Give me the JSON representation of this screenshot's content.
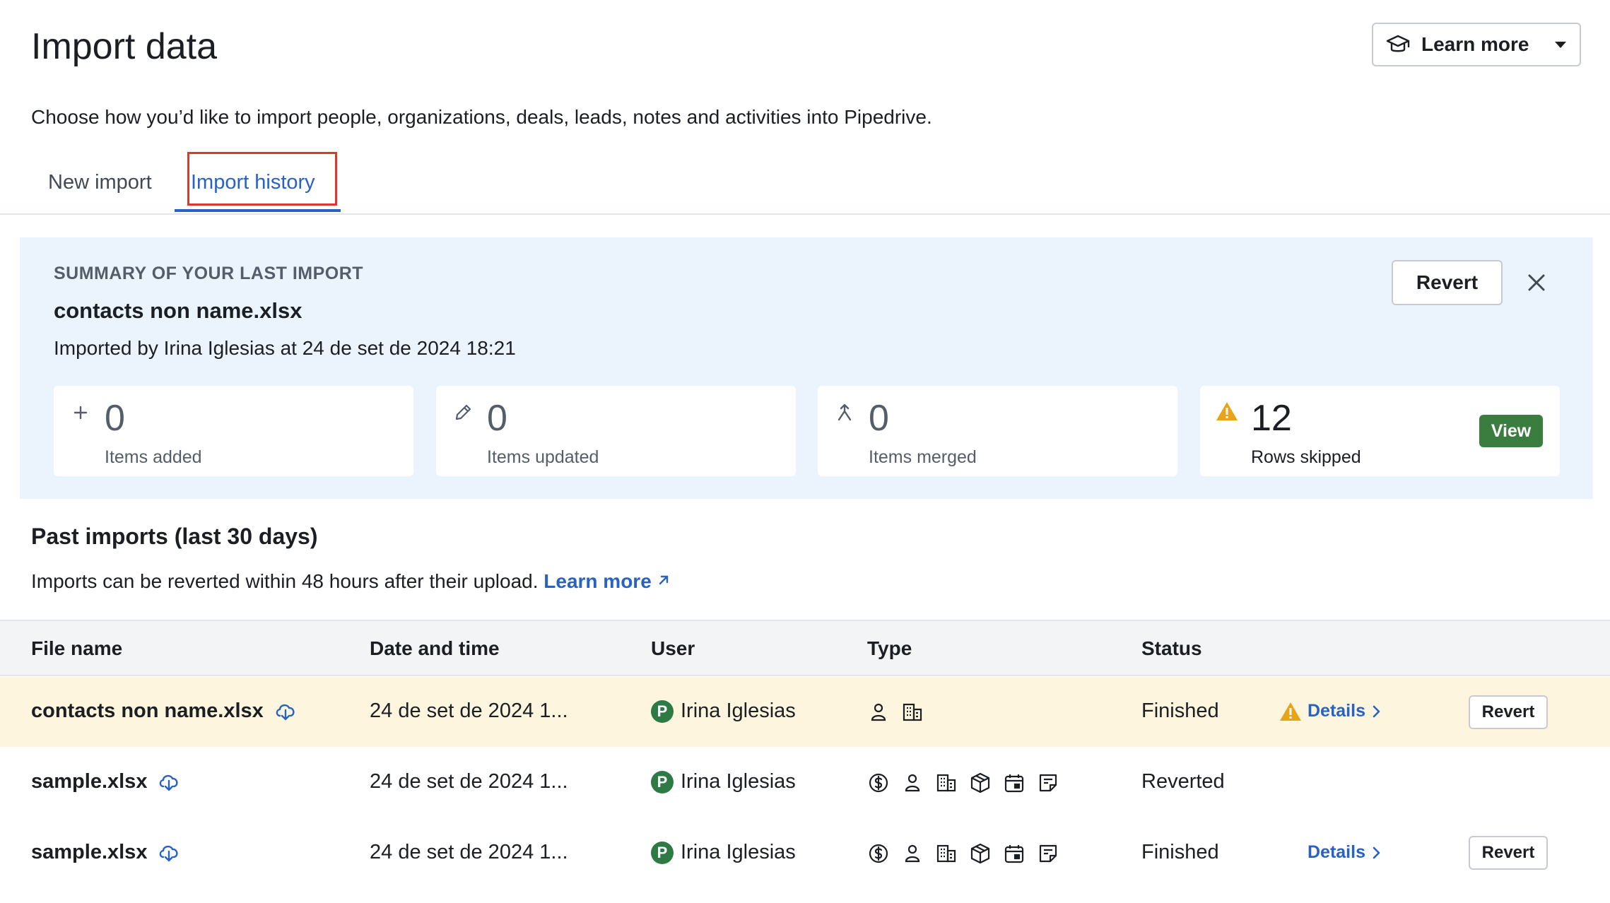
{
  "page": {
    "title": "Import data",
    "subtitle": "Choose how you’d like to import people, organizations, deals, leads, notes and activities into Pipedrive.",
    "learn_more_label": "Learn more"
  },
  "tabs": [
    {
      "label": "New import",
      "active": false
    },
    {
      "label": "Import history",
      "active": true
    }
  ],
  "summary": {
    "heading": "SUMMARY OF YOUR LAST IMPORT",
    "file_name": "contacts non name.xlsx",
    "imported_by": "Imported by Irina Iglesias at 24 de set de 2024 18:21",
    "revert_label": "Revert",
    "cards": [
      {
        "icon": "plus-icon",
        "value": "0",
        "label": "Items added"
      },
      {
        "icon": "pencil-icon",
        "value": "0",
        "label": "Items updated"
      },
      {
        "icon": "merge-icon",
        "value": "0",
        "label": "Items merged"
      },
      {
        "icon": "warning-icon",
        "value": "12",
        "label": "Rows skipped",
        "action_label": "View"
      }
    ]
  },
  "past": {
    "title": "Past imports (last 30 days)",
    "note": "Imports can be reverted within 48 hours after their upload.",
    "note_link": "Learn more",
    "columns": [
      "File name",
      "Date and time",
      "User",
      "Type",
      "Status"
    ],
    "rows": [
      {
        "file": "contacts non name.xlsx",
        "date": "24 de set de 2024 1...",
        "user": "Irina Iglesias",
        "avatar_letter": "P",
        "types": [
          "person-icon",
          "organization-icon"
        ],
        "status": "Finished",
        "details_label": "Details",
        "has_warning": true,
        "revert_label": "Revert",
        "highlighted": true
      },
      {
        "file": "sample.xlsx",
        "date": "24 de set de 2024 1...",
        "user": "Irina Iglesias",
        "avatar_letter": "P",
        "types": [
          "deal-icon",
          "person-icon",
          "organization-icon",
          "product-icon",
          "activity-icon",
          "note-icon"
        ],
        "status": "Reverted",
        "highlighted": false
      },
      {
        "file": "sample.xlsx",
        "date": "24 de set de 2024 1...",
        "user": "Irina Iglesias",
        "avatar_letter": "P",
        "types": [
          "deal-icon",
          "person-icon",
          "organization-icon",
          "product-icon",
          "activity-icon",
          "note-icon"
        ],
        "status": "Finished",
        "details_label": "Details",
        "has_warning": false,
        "revert_label": "Revert",
        "highlighted": false
      }
    ]
  },
  "colors": {
    "accent": "#2762c4",
    "highlight_row": "#fdf5dd",
    "summary_bg": "#ebf3fd",
    "view_button": "#3a7d3f",
    "warning": "#e8a317",
    "avatar": "#2d7a45",
    "tab_outline": "#d93a2b"
  }
}
